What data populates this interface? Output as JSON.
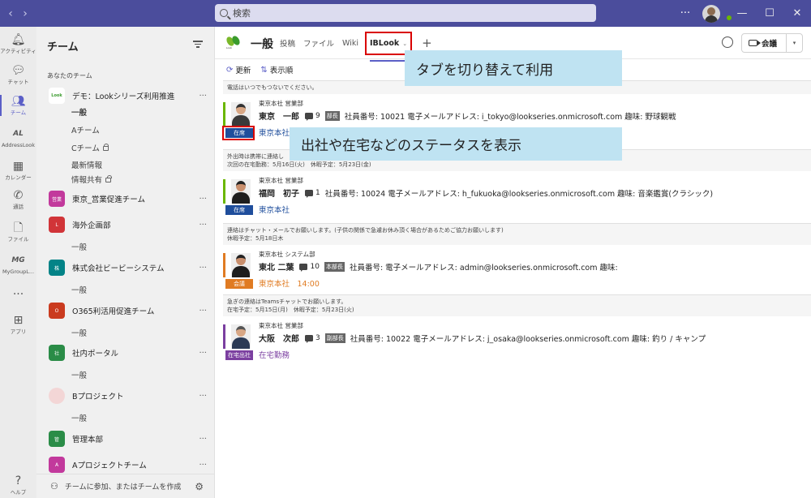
{
  "app": {
    "search_placeholder": "検索",
    "more": "···",
    "win_min": "—",
    "win_max": "☐",
    "win_close": "✕"
  },
  "rail": [
    {
      "label": "アクティビティ",
      "icon": "bell-icon",
      "glyph": "🔔︎"
    },
    {
      "label": "チャット",
      "icon": "chat-icon",
      "glyph": "💬︎"
    },
    {
      "label": "チーム",
      "icon": "teams-icon",
      "glyph": "👥︎",
      "active": true
    },
    {
      "label": "AddressLook",
      "icon": "addresslook-icon",
      "glyph": "AL"
    },
    {
      "label": "カレンダー",
      "icon": "calendar-icon",
      "glyph": "▦"
    },
    {
      "label": "通話",
      "icon": "phone-icon",
      "glyph": "✆"
    },
    {
      "label": "ファイル",
      "icon": "file-icon",
      "glyph": "🗋"
    },
    {
      "label": "MyGroupL...",
      "icon": "mygrouplook-icon",
      "glyph": "MG"
    },
    {
      "label": "",
      "icon": "more-apps-icon",
      "glyph": "···"
    },
    {
      "label": "アプリ",
      "icon": "apps-icon",
      "glyph": "⊞"
    },
    {
      "label": "ヘルプ",
      "icon": "help-icon",
      "glyph": "?"
    }
  ],
  "panel": {
    "title": "チーム",
    "section": "あなたのチーム",
    "footer": "チームに参加、またはチームを作成",
    "teams": [
      {
        "name": "デモ：Lookシリーズ利用推進",
        "avatar_text": "Look",
        "color": "#ffffff"
      },
      {
        "name": "東京_営業促進チーム",
        "avatar_text": "営業",
        "color": "#c2399c"
      },
      {
        "name": "海外企画部",
        "avatar_text": "L",
        "color": "#d13438"
      },
      {
        "name": "株式会社ビービーシステム",
        "avatar_text": "株",
        "color": "#038387"
      },
      {
        "name": "O365利活用促進チーム",
        "avatar_text": "O",
        "color": "#ca3b1f"
      },
      {
        "name": "社内ポータル",
        "avatar_text": "社",
        "color": "#2a8c47"
      },
      {
        "name": "Bプロジェクト",
        "avatar_text": "",
        "color": "#f3d6d6"
      },
      {
        "name": "管理本部",
        "avatar_text": "管",
        "color": "#2a8c47"
      },
      {
        "name": "Aプロジェクトチーム",
        "avatar_text": "A",
        "color": "#c2399c"
      }
    ],
    "channels": [
      {
        "name": "一般",
        "selected": true
      },
      {
        "name": "Aチーム"
      },
      {
        "name": "Cチーム",
        "lock": true
      },
      {
        "name": "最新情報"
      },
      {
        "name": "情報共有",
        "lock": true
      },
      {
        "name": "一般"
      },
      {
        "name": "一般"
      },
      {
        "name": "一般"
      },
      {
        "name": "一般"
      },
      {
        "name": "一般"
      }
    ]
  },
  "channel": {
    "name": "一般",
    "tabs": [
      "投稿",
      "ファイル",
      "Wiki",
      "IBLook"
    ],
    "active_tab": "IBLook",
    "meet_label": "会議"
  },
  "toolbar": {
    "refresh": "更新",
    "sort": "表示順"
  },
  "cards": [
    {
      "notice": [
        "電話はいつでもつないでください。"
      ],
      "dept": "東京本社 営業部",
      "name": "東京　一郎",
      "count": "9",
      "role": "部長",
      "info": "社員番号: 10021 電子メールアドレス: i_tokyo@lookseries.onmicrosoft.com 趣味: 野球観戦",
      "status": "在席",
      "status_color": "#1f4e9c",
      "bar_color": "#6bb700",
      "loc": "東京本社",
      "loc_color": "#1f4e9c"
    },
    {
      "notice": [
        "外出時は携帯に連絡し",
        "次回の在宅勤務：5月16日(火)　休暇予定：5月23日(金)"
      ],
      "dept": "東京本社 営業部",
      "name": "福岡　初子",
      "count": "1",
      "role": "",
      "info": "社員番号: 10024 電子メールアドレス: h_fukuoka@lookseries.onmicrosoft.com 趣味: 音楽鑑賞(クラシック)",
      "status": "在席",
      "status_color": "#1f4e9c",
      "bar_color": "#6bb700",
      "loc": "東京本社",
      "loc_color": "#1f4e9c"
    },
    {
      "notice": [
        "連絡はチャット・メールでお願いします。(子供の関係で急遽お休み頂く場合があるためご協力お願いします)",
        "休暇予定：5月18日木"
      ],
      "dept": "東京本社 システム部",
      "name": "東北 二葉",
      "count": "10",
      "role": "本部長",
      "info": "社員番号: 電子メールアドレス: admin@lookseries.onmicrosoft.com 趣味:",
      "status": "会議",
      "status_color": "#e07b22",
      "bar_color": "#e07b22",
      "loc": "東京本社　14:00",
      "loc_color": "#e07b22"
    },
    {
      "notice": [
        "急ぎの連絡はTeamsチャットでお願いします。",
        "在宅予定：5月15日(月)　休暇予定：5月23日(火)"
      ],
      "dept": "東京本社 営業部",
      "name": "大阪　次郎",
      "count": "3",
      "role": "副部長",
      "info": "社員番号: 10022 電子メールアドレス: j_osaka@lookseries.onmicrosoft.com 趣味: 釣り / キャンプ",
      "status": "在宅出社",
      "status_color": "#7b3fa0",
      "bar_color": "#7b3fa0",
      "loc": "在宅勤務",
      "loc_color": "#7b3fa0"
    }
  ],
  "callouts": {
    "tab": "タブを切り替えて利用",
    "status": "出社や在宅などのステータスを表示"
  }
}
